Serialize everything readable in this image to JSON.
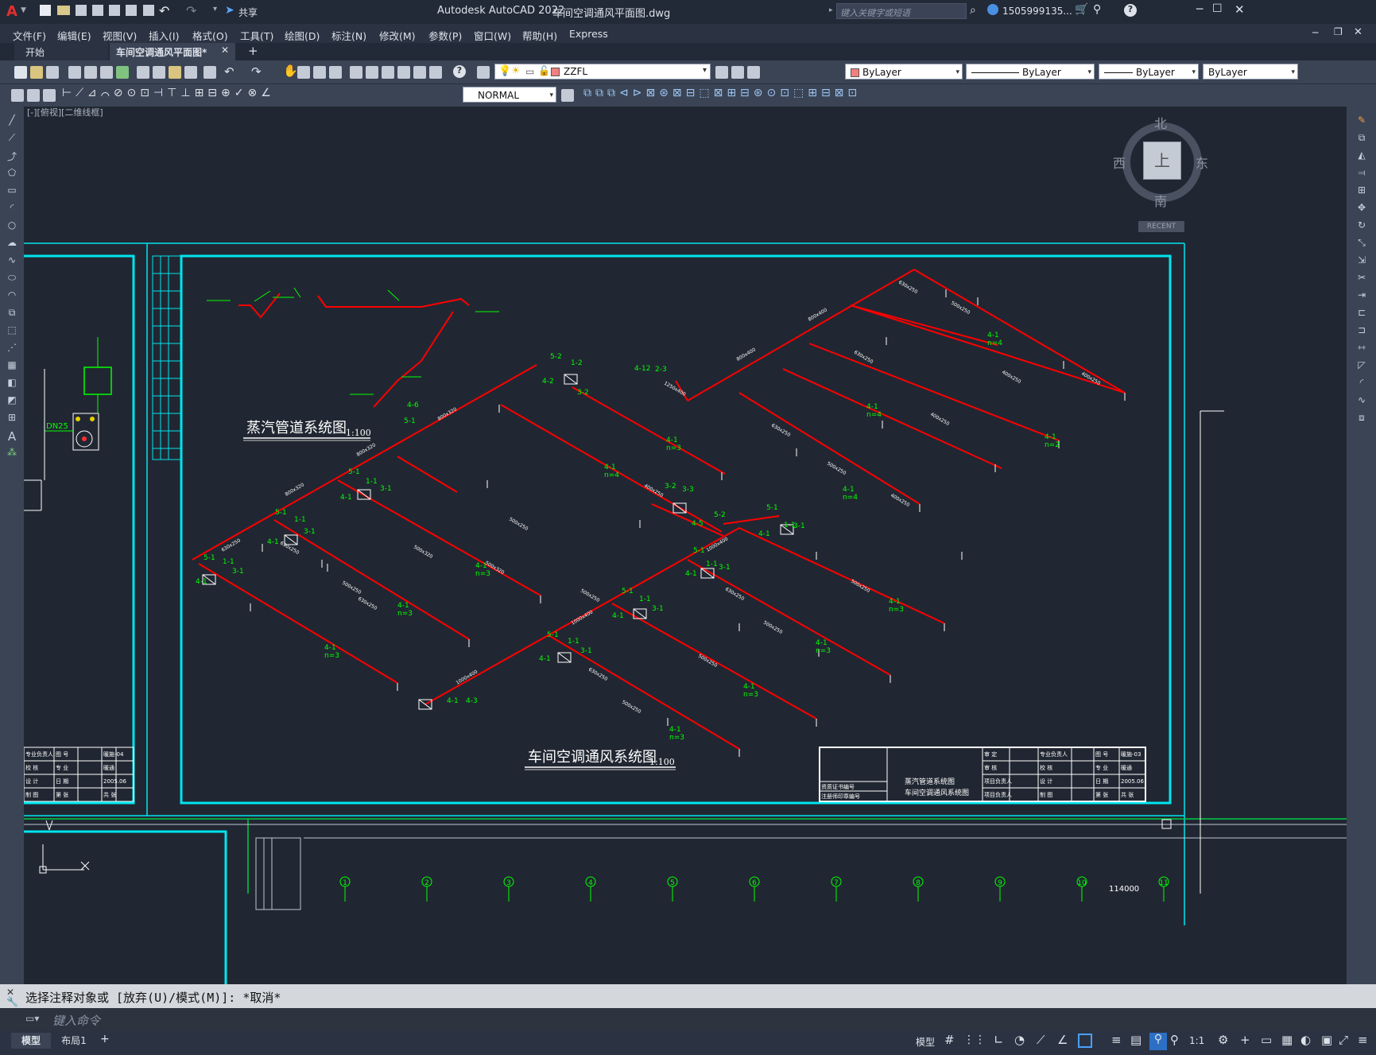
{
  "app": {
    "title": "Autodesk AutoCAD 2022",
    "document": "车间空调通风平面图.dwg",
    "share_label": "共享",
    "search_placeholder": "键入关键字或短语",
    "user": "1505999135...",
    "logo_letter": "A"
  },
  "menu": [
    "文件(F)",
    "编辑(E)",
    "视图(V)",
    "插入(I)",
    "格式(O)",
    "工具(T)",
    "绘图(D)",
    "标注(N)",
    "修改(M)",
    "参数(P)",
    "窗口(W)",
    "帮助(H)",
    "Express"
  ],
  "tabs": [
    {
      "label": "开始",
      "active": false
    },
    {
      "label": "车间空调通风平面图*",
      "active": true
    }
  ],
  "toolbar": {
    "layer_name": "ZZFL",
    "color": "ByLayer",
    "linetype": "ByLayer",
    "lineweight": "ByLayer",
    "plotstyle": "ByLayer",
    "dimstyle": "NORMAL"
  },
  "viewport": {
    "label": "[-][俯视][二维线框]",
    "viewcube": {
      "north": "北",
      "south": "南",
      "east": "东",
      "west": "西",
      "top": "上",
      "recent": "RECENT"
    }
  },
  "drawing": {
    "steam_title": "蒸汽管道系统图",
    "steam_scale": "1:100",
    "hvac_title": "车间空调通风系统图",
    "hvac_scale": "1:100",
    "dn_label": "DN25",
    "total_dim": "114000",
    "axis_numbers": [
      "1",
      "2",
      "3",
      "4",
      "5",
      "6",
      "7",
      "8",
      "9",
      "10",
      "11"
    ],
    "left_titleblock": [
      [
        "专业负责人",
        "图 号",
        "暖施-04"
      ],
      [
        "校 核",
        "专 业",
        "暖通"
      ],
      [
        "设 计",
        "日 期",
        "2005.06"
      ],
      [
        "制 图",
        "第 张",
        "共 张"
      ]
    ],
    "right_titleblock": {
      "center": [
        "蒸汽管道系统图",
        "车间空调通风系统图"
      ],
      "left": [
        "资质证书编号",
        "注册师印章编号"
      ],
      "col1": [
        "审 定",
        "审 核",
        "项目负责人",
        "项目负责人"
      ],
      "col2": [
        "专业负责人",
        "校 核",
        "设 计",
        "制 图"
      ],
      "col3": [
        "图 号",
        "专 业",
        "日 期",
        "第 张"
      ],
      "col4": [
        "暖施-03",
        "暖通",
        "2005.06",
        "共 张"
      ]
    }
  },
  "command": {
    "history": "选择注释对象或 [放弃(U)/模式(M)]: *取消*",
    "placeholder": "键入命令"
  },
  "layout_tabs": [
    "模型",
    "布局1"
  ],
  "status": {
    "model_label": "模型",
    "scale": "1:1"
  },
  "colors": {
    "duct": "#ff0000",
    "annot": "#00ff00",
    "frame": "#00e5ee",
    "bg": "#212732"
  }
}
